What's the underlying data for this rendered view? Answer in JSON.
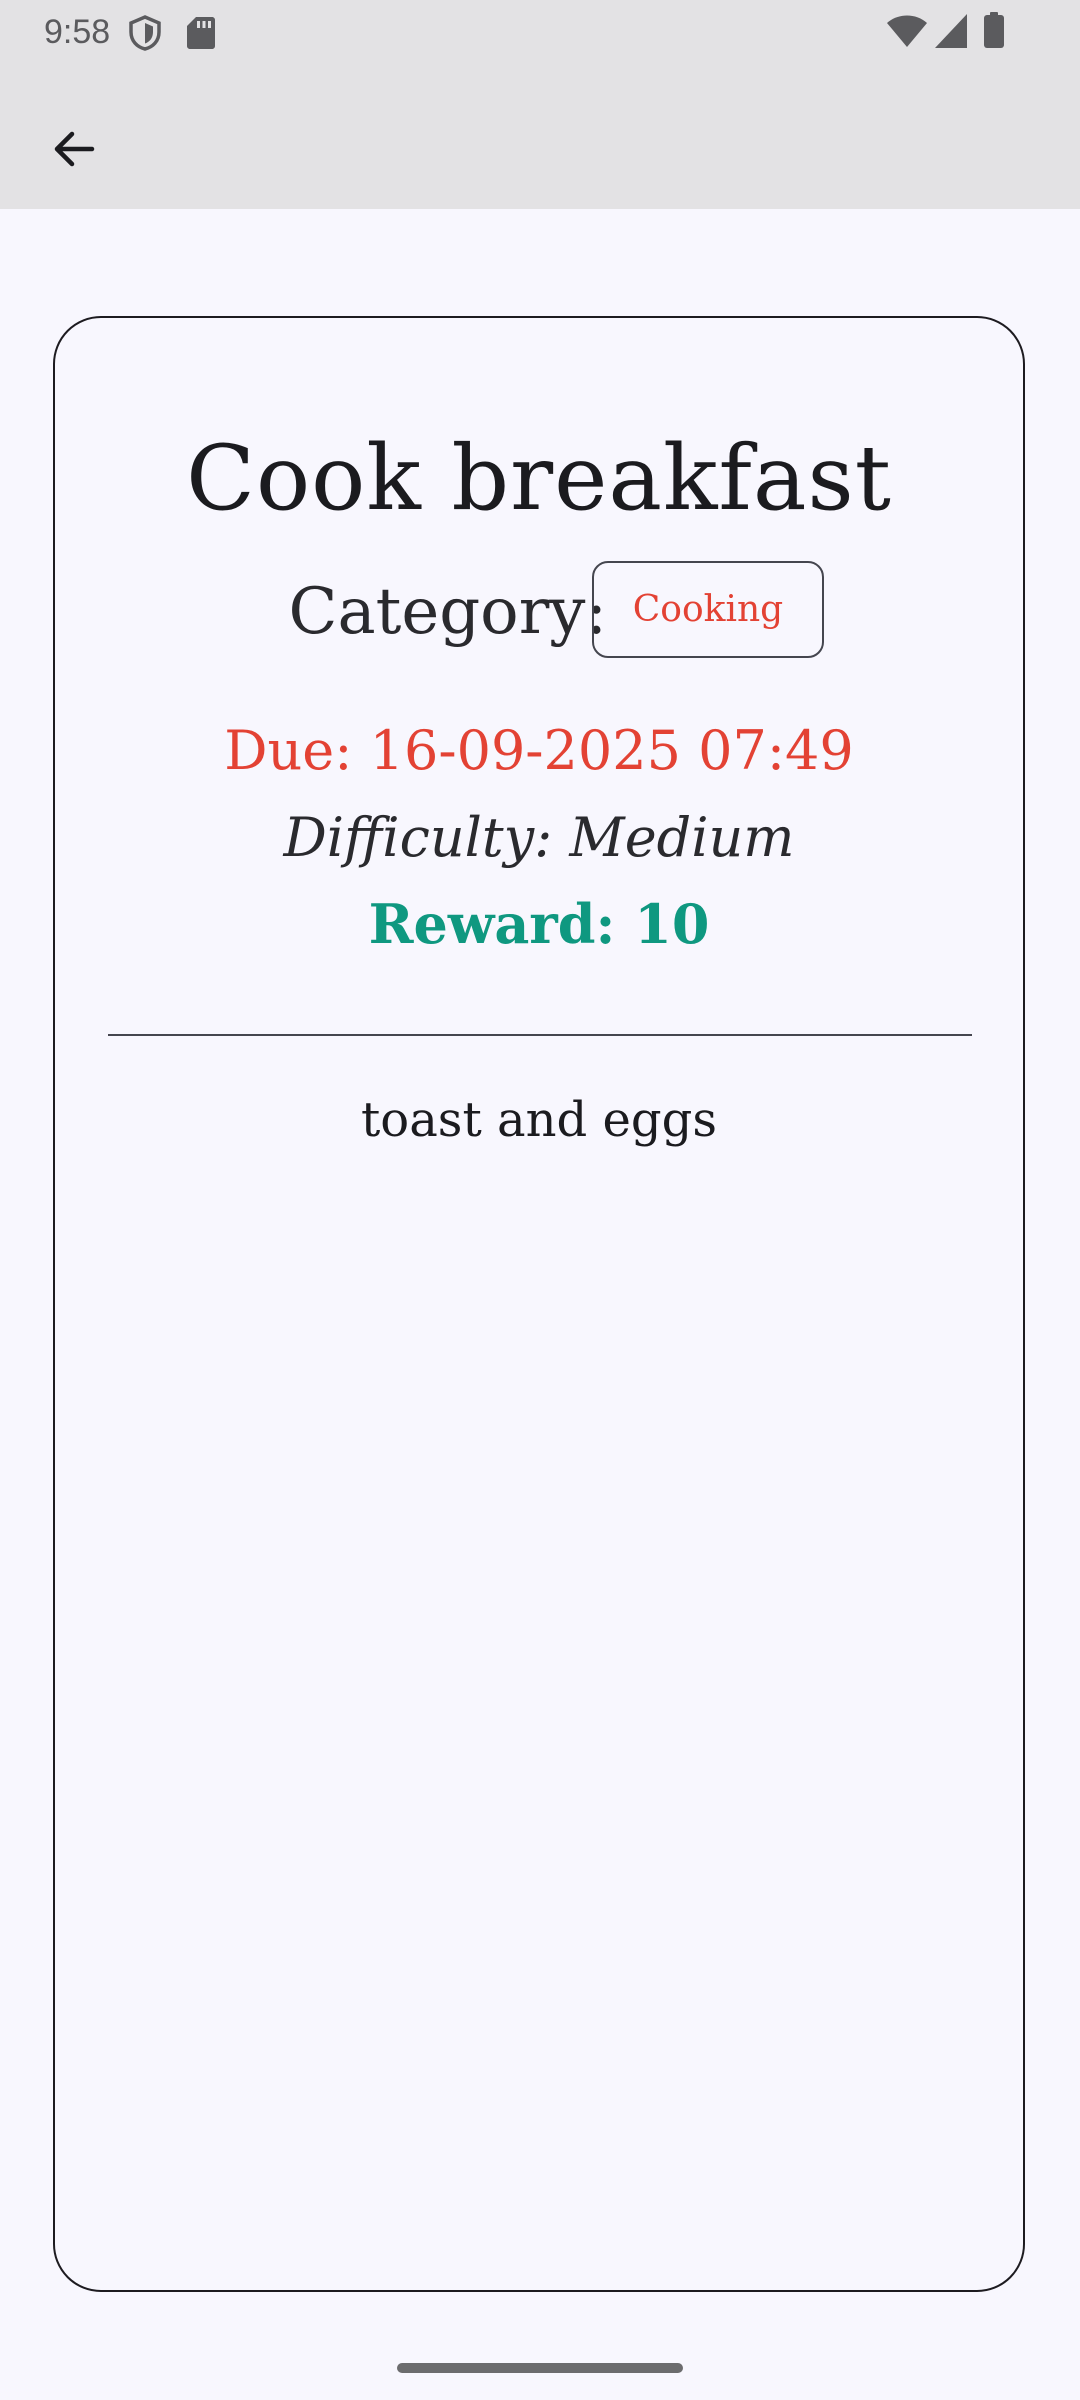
{
  "status_bar": {
    "time": "9:58",
    "icons": [
      "shield-icon",
      "sd-card-icon",
      "wifi-icon",
      "signal-icon",
      "battery-icon"
    ]
  },
  "app_bar": {
    "back_icon": "arrow-back-icon"
  },
  "task": {
    "title": "Cook breakfast",
    "category_label": "Category:",
    "category": "Cooking",
    "due": "Due: 16-09-2025 07:49",
    "difficulty": "Difficulty: Medium",
    "reward": "Reward: 10",
    "description": "toast and eggs"
  },
  "colors": {
    "due": "#e34234",
    "category_chip_text": "#e34234",
    "reward": "#0f9880",
    "app_bar_background": "#e3e2e4",
    "page_background": "#f8f7fe"
  }
}
